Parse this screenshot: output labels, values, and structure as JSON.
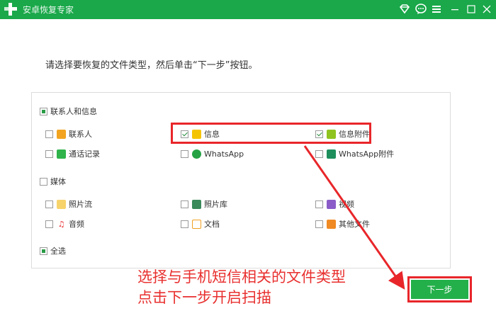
{
  "app": {
    "title": "安卓恢复专家"
  },
  "instruction": "请选择要恢复的文件类型，然后单击“下一步”按钮。",
  "groups": {
    "contacts": {
      "label": "联系人和信息",
      "items": [
        {
          "label": "联系人",
          "checked": false
        },
        {
          "label": "信息",
          "checked": true
        },
        {
          "label": "信息附件",
          "checked": true
        },
        {
          "label": "通话记录",
          "checked": false
        },
        {
          "label": "WhatsApp",
          "checked": false
        },
        {
          "label": "WhatsApp附件",
          "checked": false
        }
      ]
    },
    "media": {
      "label": "媒体",
      "items": [
        {
          "label": "照片流",
          "checked": false
        },
        {
          "label": "照片库",
          "checked": false
        },
        {
          "label": "视频",
          "checked": false
        },
        {
          "label": "音频",
          "checked": false
        },
        {
          "label": "文档",
          "checked": false
        },
        {
          "label": "其他文件",
          "checked": false
        }
      ]
    },
    "select_all": {
      "label": "全选"
    }
  },
  "annotation": {
    "line1": "选择与手机短信相关的文件类型",
    "line2": "点击下一步开启扫描"
  },
  "next_button": "下一步",
  "colors": {
    "brand": "#1aa84a",
    "button": "#23b04a",
    "annotation": "#e8262a"
  }
}
